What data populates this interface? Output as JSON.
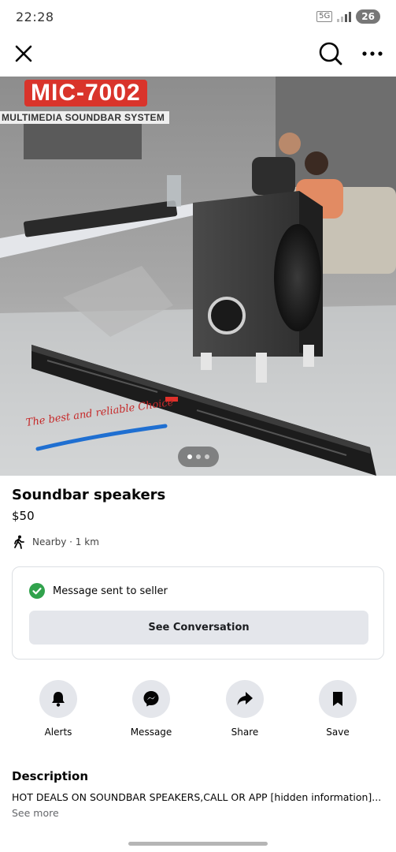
{
  "status_bar": {
    "time": "22:28",
    "network": "5G",
    "battery": "26"
  },
  "top_bar": {
    "close_icon": "close-icon",
    "search_icon": "search-icon",
    "more_icon": "more-dots-icon"
  },
  "hero": {
    "brand": "MIC-7002",
    "subtitle": "MULTIMEDIA SOUNDBAR SYSTEM",
    "slogan": "The best and reliable Choice",
    "page_count": 3,
    "current_page": 1
  },
  "listing": {
    "title": "Soundbar speakers",
    "price": "$50",
    "location": "Nearby · 1 km"
  },
  "message": {
    "status": "Message sent to seller",
    "button": "See Conversation",
    "accent": "#31a24c"
  },
  "actions": [
    {
      "label": "Alerts",
      "icon": "bell-icon"
    },
    {
      "label": "Message",
      "icon": "messenger-icon"
    },
    {
      "label": "Share",
      "icon": "share-icon"
    },
    {
      "label": "Save",
      "icon": "bookmark-icon"
    }
  ],
  "description": {
    "heading": "Description",
    "text": "HOT DEALS ON SOUNDBAR SPEAKERS,CALL OR APP [hidden information]...",
    "see_more": "See more"
  }
}
